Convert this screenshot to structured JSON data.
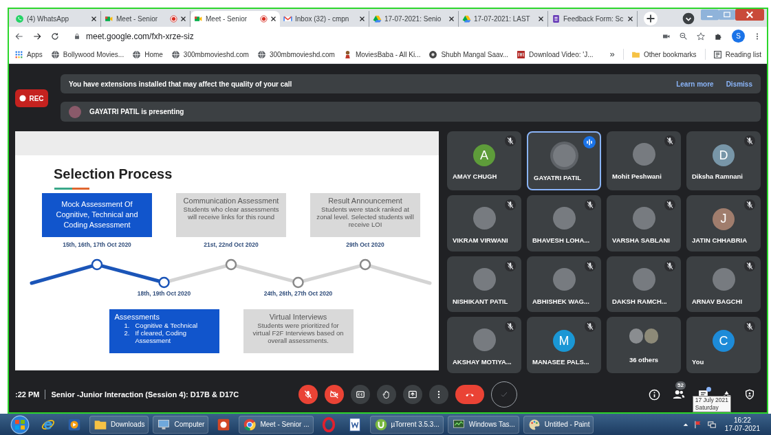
{
  "tabs": [
    {
      "kind": "whatsapp",
      "title": "(4) WhatsApp",
      "recording": false,
      "selected": false
    },
    {
      "kind": "meet",
      "title": "Meet - Senior",
      "recording": true,
      "selected": false
    },
    {
      "kind": "meet",
      "title": "Meet - Senior",
      "recording": true,
      "selected": true
    },
    {
      "kind": "gmail",
      "title": "Inbox (32) - cmpn",
      "recording": false,
      "selected": false
    },
    {
      "kind": "drive",
      "title": "17-07-2021: Senio",
      "recording": false,
      "selected": false
    },
    {
      "kind": "drive",
      "title": "17-07-2021: LAST",
      "recording": false,
      "selected": false
    },
    {
      "kind": "forms",
      "title": "Feedback Form: Sc",
      "recording": false,
      "selected": false
    }
  ],
  "address_bar": {
    "url": "meet.google.com/fxh-xrze-siz",
    "profile_initial": "S"
  },
  "bookmarks": [
    {
      "kind": "apps",
      "label": "Apps"
    },
    {
      "kind": "globe",
      "label": "Bollywood Movies..."
    },
    {
      "kind": "globe",
      "label": "Home"
    },
    {
      "kind": "globe",
      "label": "300mbmovieshd.com"
    },
    {
      "kind": "globe",
      "label": "300mbmovieshd.com"
    },
    {
      "kind": "mascot",
      "label": "MoviesBaba - All Ki..."
    },
    {
      "kind": "ball",
      "label": "Shubh Mangal Saav..."
    },
    {
      "kind": "video",
      "label": "Download Video: 'J..."
    },
    {
      "kind": "overflow",
      "label": "»"
    },
    {
      "kind": "folder",
      "label": "Other bookmarks"
    },
    {
      "kind": "reading",
      "label": "Reading list"
    }
  ],
  "rec_label": "REC",
  "notice": {
    "text": "You have extensions installed that may affect the quality of your call",
    "links": [
      "Learn more",
      "Dismiss"
    ]
  },
  "presenting": "GAYATRI PATIL is presenting",
  "slide": {
    "title": "Selection Process",
    "stages": [
      {
        "kind": "above",
        "active": true,
        "date": "15th, 16th, 17th Oct 2020",
        "title": "Mock Assessment Of Cognitive, Technical and Coding Assessment"
      },
      {
        "kind": "below",
        "active": true,
        "date": "18th, 19th Oct 2020",
        "title": "Assessments",
        "items": [
          {
            "number": "1.",
            "text": "Cognitive & Technical"
          },
          {
            "number": "2.",
            "text": "If cleared, Coding Assessment"
          }
        ]
      },
      {
        "kind": "above",
        "active": false,
        "date": "21st, 22nd Oct 2020",
        "title": "Communication Assessment",
        "body": "Students who clear assessments will receive links for this round"
      },
      {
        "kind": "below",
        "active": false,
        "date": "24th, 26th, 27th Oct 2020",
        "title": "Virtual Interviews",
        "body": "Students were prioritized for virtual F2F Interviews based on overall assessments."
      },
      {
        "kind": "above",
        "active": false,
        "date": "29th Oct 2020",
        "title": "Result Announcement",
        "body": "Students were stack ranked at zonal level. Selected students will receive LOI"
      }
    ]
  },
  "participants": [
    {
      "name": "AMAY CHUGH",
      "kind": "initial",
      "initial": "A",
      "color": "#5e9c3a",
      "muted": true,
      "speaking": false
    },
    {
      "name": "GAYATRI PATIL",
      "kind": "photo",
      "muted": false,
      "speaking": true
    },
    {
      "name": "Mohit Peshwani",
      "kind": "photo",
      "muted": true,
      "speaking": false
    },
    {
      "name": "Diksha Ramnani",
      "kind": "initial",
      "initial": "D",
      "color": "#7896a8",
      "muted": true,
      "speaking": false
    },
    {
      "name": "VIKRAM VIRWANI",
      "kind": "photo",
      "muted": true,
      "speaking": false
    },
    {
      "name": "BHAVESH LOHA...",
      "kind": "photo",
      "muted": true,
      "speaking": false
    },
    {
      "name": "VARSHA SABLANI",
      "kind": "photo",
      "muted": true,
      "speaking": false
    },
    {
      "name": "JATIN CHHABRIA",
      "kind": "initial",
      "initial": "J",
      "color": "#a07d6d",
      "muted": true,
      "speaking": false
    },
    {
      "name": "NISHIKANT PATIL",
      "kind": "photo",
      "muted": true,
      "speaking": false
    },
    {
      "name": "ABHISHEK WAG...",
      "kind": "photo",
      "muted": true,
      "speaking": false
    },
    {
      "name": "DAKSH RAMCH...",
      "kind": "photo",
      "muted": true,
      "speaking": false
    },
    {
      "name": "ARNAV BAGCHI",
      "kind": "photo",
      "muted": true,
      "speaking": false
    },
    {
      "name": "AKSHAY MOTIYA...",
      "kind": "photo",
      "muted": true,
      "speaking": false
    },
    {
      "name": "MANASEE PALS...",
      "kind": "initial",
      "initial": "M",
      "color": "#1a97d5",
      "muted": true,
      "speaking": false
    },
    {
      "name": "36 others",
      "kind": "group",
      "muted": false,
      "speaking": false
    },
    {
      "name": "You",
      "kind": "initial",
      "initial": "C",
      "color": "#1d8bd8",
      "muted": true,
      "speaking": false
    }
  ],
  "bottom_bar": {
    "time": ":22 PM",
    "meeting_title": "Senior -Junior Interaction (Session 4): D17B & D17C",
    "mic": {
      "off": true
    },
    "camera": {
      "off": true
    },
    "controls": [
      {
        "kind": "captions"
      },
      {
        "kind": "hand"
      },
      {
        "kind": "present"
      },
      {
        "kind": "more"
      },
      {
        "kind": "hangup"
      },
      {
        "kind": "check"
      }
    ],
    "people_count": "52",
    "chat_unread": true,
    "tooltip": [
      "17 July 2021",
      "Saturday"
    ]
  },
  "taskbar": {
    "items": [
      {
        "kind": "start"
      },
      {
        "kind": "ie"
      },
      {
        "kind": "media"
      },
      {
        "kind": "folder",
        "label": "Downloads"
      },
      {
        "kind": "computer",
        "label": "Computer"
      },
      {
        "kind": "slides"
      },
      {
        "kind": "chrome",
        "label": "Meet - Senior ..."
      },
      {
        "kind": "opera"
      },
      {
        "kind": "word"
      },
      {
        "kind": "torrent",
        "label": "µTorrent 3.5.3..."
      },
      {
        "kind": "taskmgr",
        "label": "Windows Tas..."
      },
      {
        "kind": "paint",
        "label": "Untitled - Paint"
      }
    ],
    "clock": [
      "16:22",
      "17-07-2021"
    ]
  }
}
